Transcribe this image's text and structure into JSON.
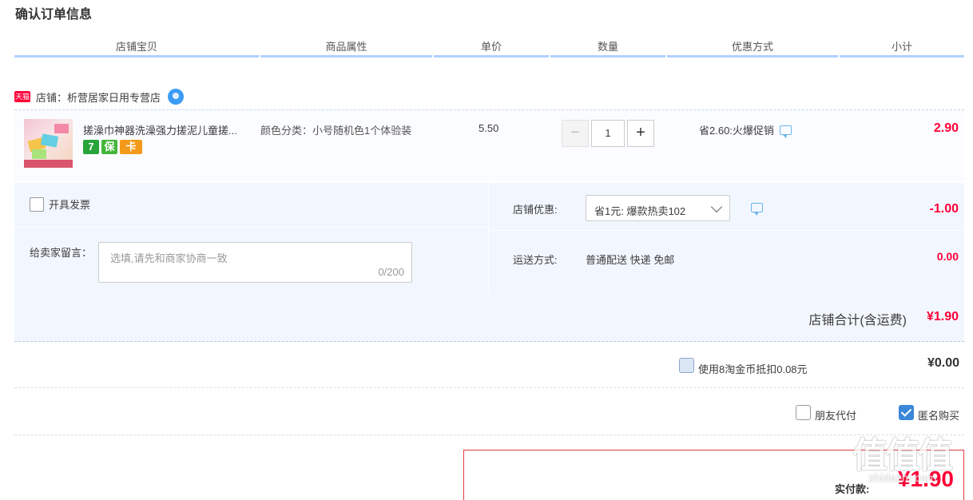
{
  "title": "确认订单信息",
  "columns": [
    "店铺宝贝",
    "商品属性",
    "单价",
    "数量",
    "优惠方式",
    "小计"
  ],
  "shop": {
    "badge": "天猫",
    "name": "店铺：析营居家日用专营店"
  },
  "item": {
    "title": "搓澡巾神器洗澡强力搓泥儿童搓...",
    "sku": "颜色分类：小号随机色1个体验装",
    "price": "5.50",
    "quantity": "1",
    "minus": "−",
    "plus": "+",
    "promo": "省2.60:火爆促销",
    "subtotal": "2.90",
    "service_icons": [
      "7",
      "保",
      "卡"
    ]
  },
  "options": {
    "invoice_label": "开具发票",
    "message_label": "给卖家留言：",
    "message_placeholder": "选填,请先和商家协商一致",
    "message_count": "0/200",
    "shop_discount_label": "店铺优惠:",
    "shop_discount_value": "省1元: 爆款热卖102",
    "shop_discount_amount": "-1.00",
    "shipping_label": "运送方式:",
    "shipping_value": "普通配送 快递 免邮",
    "shipping_amount": "0.00"
  },
  "shop_total": {
    "label": "店铺合计(含运费)",
    "amount": "¥1.90"
  },
  "coins": {
    "label": "使用8淘金币抵扣0.08元",
    "amount": "¥0.00"
  },
  "payment": {
    "friend_pay": "朋友代付",
    "anonymous": "匿名购买"
  },
  "final": {
    "label": "实付款:",
    "amount": "¥1.90"
  },
  "watermark": {
    "chars": "值值值",
    "url": "zhidezhi.com"
  },
  "colors": {
    "accent_red": "#ff0036",
    "header_line": "#b2d1ff",
    "panel_bg": "#f2f7ff"
  }
}
